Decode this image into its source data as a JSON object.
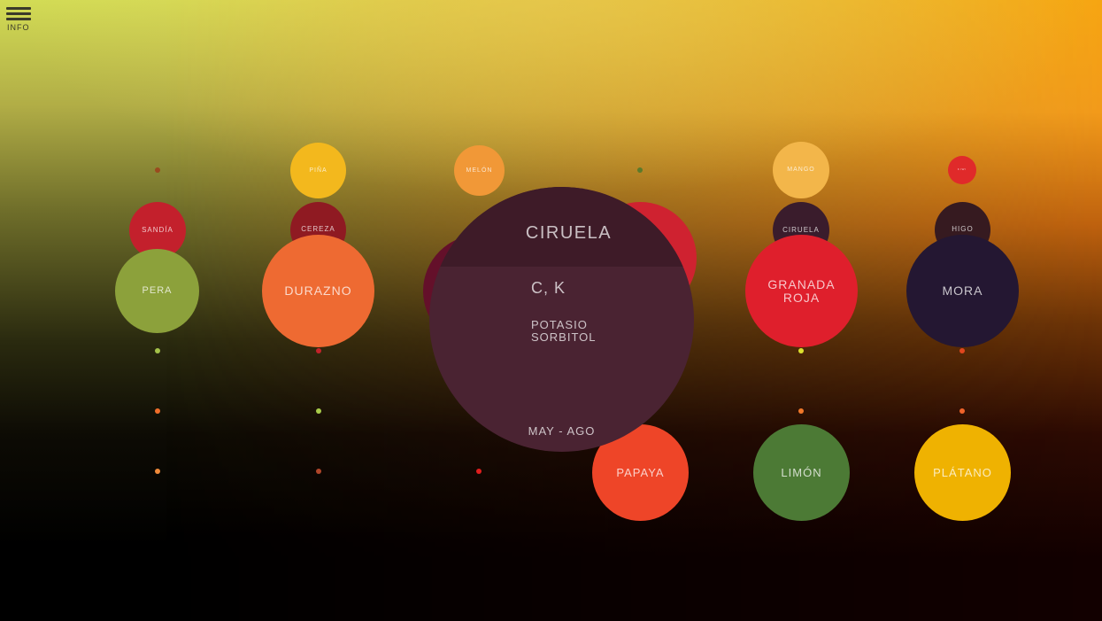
{
  "menu": {
    "label": "INFO",
    "icon": "hamburger-menu-icon"
  },
  "popup": {
    "name": "CIRUELA",
    "vitamins": "C, K",
    "minerals": [
      "POTASIO",
      "SORBITOL"
    ],
    "season": "MAY - AGO"
  },
  "fruits": [
    {
      "label": "PIÑA",
      "color": "#f3b81d"
    },
    {
      "label": "MELÓN",
      "color": "#f19837"
    },
    {
      "label": "MANGO",
      "color": "#f3b64a"
    },
    {
      "label": "KIWI",
      "color": "#e02a2a"
    },
    {
      "label": "SANDÍA",
      "color": "#c3202c"
    },
    {
      "label": "CEREZA",
      "color": "#8f1a22"
    },
    {
      "label": "CIRUELA",
      "color": "#3a1c2c"
    },
    {
      "label": "HIGO",
      "color": "#361a20"
    },
    {
      "label": "PERA",
      "color": "#8ca13b"
    },
    {
      "label": "DURAZNO",
      "color": "#ee6a32"
    },
    {
      "label": "",
      "color": "#64102a"
    },
    {
      "label": "",
      "color": "#cf2230"
    },
    {
      "label": "GRANADA ROJA",
      "color": "#df1f2c"
    },
    {
      "label": "MORA",
      "color": "#241732"
    },
    {
      "label": "PAPAYA",
      "color": "#ee4528"
    },
    {
      "label": "LIMÓN",
      "color": "#4c7a35"
    },
    {
      "label": "PLÁTANO",
      "color": "#efb201"
    }
  ],
  "dot_colors": [
    "#9a4a1e",
    "#5b7a2a",
    "#a4c24a",
    "#c4222a",
    "#dbe12e",
    "#e0461e",
    "#f06e2a",
    "#a8cc4a",
    "#f0782a",
    "#f0642a",
    "#ef8a3a",
    "#b0462a",
    "#e01e1e"
  ]
}
